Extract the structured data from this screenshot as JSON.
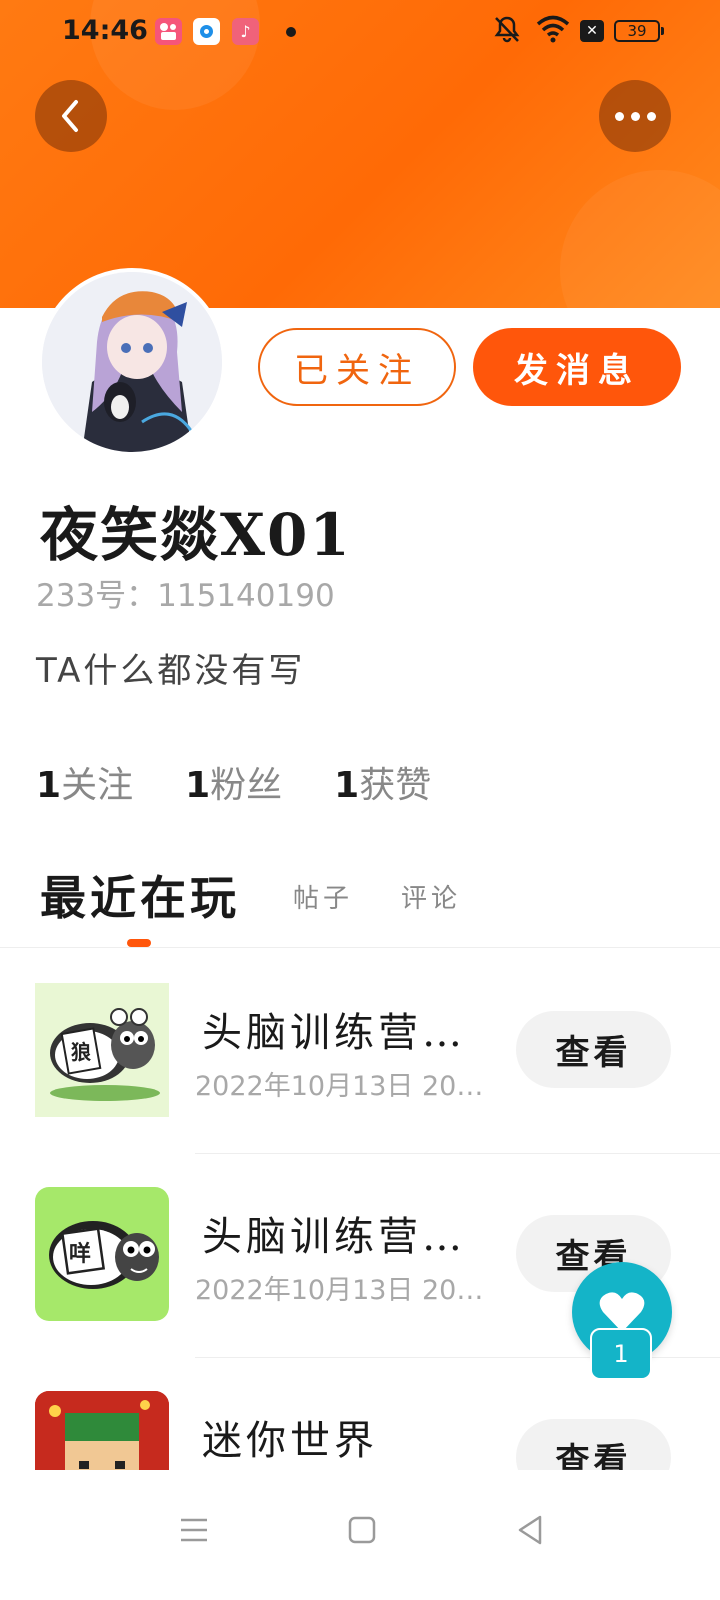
{
  "status_bar": {
    "time": "14:46",
    "battery": "39",
    "sim_icon": "sim-x-icon",
    "notification_apps": [
      "kuaishou-app-icon",
      "browser-app-icon",
      "music-app-icon"
    ]
  },
  "header": {
    "back_icon": "chevron-left-icon",
    "more_icon": "more-dots-icon",
    "gradient_colors": [
      "#ff7a12",
      "#ff6a06",
      "#ff8a1e"
    ]
  },
  "profile": {
    "follow_label": "已关注",
    "message_label": "发消息",
    "username": "夜笑燚X01",
    "id_text": "233号：115140190",
    "bio": "TA什么都没有写",
    "stats": [
      {
        "num": "1",
        "label": "关注"
      },
      {
        "num": "1",
        "label": "粉丝"
      },
      {
        "num": "1",
        "label": "获赞"
      }
    ]
  },
  "tabs": {
    "active": "最近在玩",
    "posts": "帖子",
    "comments": "评论"
  },
  "games": [
    {
      "title": "头脑训练营…",
      "date": "2022年10月13日  20…",
      "view_label": "查看",
      "thumb_text": "狼"
    },
    {
      "title": "头脑训练营…",
      "date": "2022年10月13日  20…",
      "view_label": "查看",
      "thumb_text": "咩"
    },
    {
      "title": "迷你世界",
      "date": "",
      "view_label": "查看",
      "thumb_text": ""
    }
  ],
  "fab": {
    "badge": "1",
    "icon": "heart-icon"
  },
  "colors": {
    "accent": "#ff560b",
    "teal": "#14b4c8"
  }
}
